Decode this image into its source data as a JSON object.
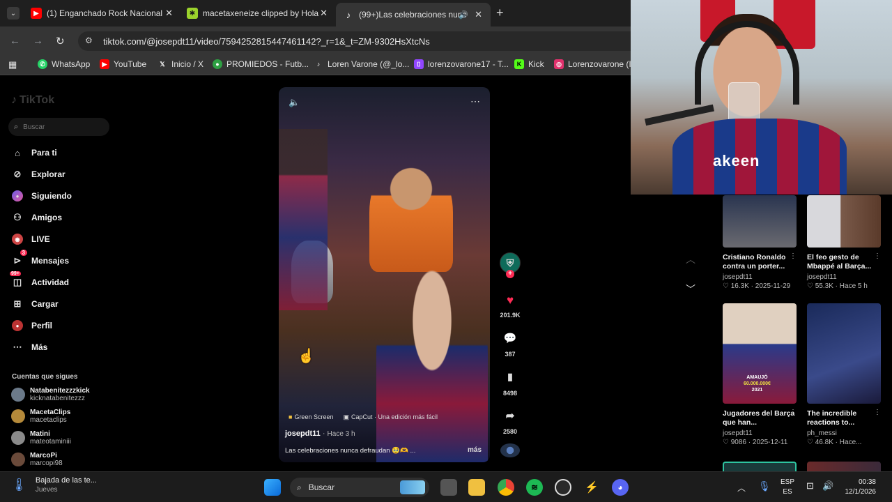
{
  "browser": {
    "tabs": [
      {
        "title": "(1) Enganchado Rock Nacional",
        "favicon": "youtube-icon",
        "color": "#ff0000"
      },
      {
        "title": "macetaxeneize clipped by Hola",
        "favicon": "clip-icon",
        "color": "#9bd32c"
      },
      {
        "title": "(99+)Las celebraciones nunc",
        "favicon": "tiktok-icon",
        "color": "#ffffff"
      }
    ],
    "new_tab": "+",
    "url": "tiktok.com/@josepdt11/video/7594252815447461142?_r=1&_t=ZM-9302HsXtcNs",
    "bookmarks": [
      {
        "label": "WhatsApp",
        "icon": "whatsapp-icon",
        "color": "#25d366"
      },
      {
        "label": "YouTube",
        "icon": "youtube-icon",
        "color": "#ff0000"
      },
      {
        "label": "Inicio / X",
        "icon": "x-icon",
        "color": "#ffffff"
      },
      {
        "label": "PROMIEDOS - Futb...",
        "icon": "promiedos-icon",
        "color": "#2ea043"
      },
      {
        "label": "Loren Varone (@_lo...",
        "icon": "tiktok-icon",
        "color": "#ffffff"
      },
      {
        "label": "lorenzovarone17 - T...",
        "icon": "twitch-icon",
        "color": "#9146ff"
      },
      {
        "label": "Kick",
        "icon": "kick-icon",
        "color": "#53fc18"
      },
      {
        "label": "Lorenzovarone (In",
        "icon": "instagram-icon",
        "color": "#e1306c"
      }
    ]
  },
  "tiktok": {
    "logo": "TikTok",
    "search_placeholder": "Buscar",
    "nav": [
      {
        "label": "Para ti",
        "icon": "home-icon"
      },
      {
        "label": "Explorar",
        "icon": "compass-icon"
      },
      {
        "label": "Siguiendo",
        "icon": "following-icon"
      },
      {
        "label": "Amigos",
        "icon": "friends-icon"
      },
      {
        "label": "LIVE",
        "icon": "live-icon"
      },
      {
        "label": "Mensajes",
        "icon": "messages-icon",
        "badge": "3"
      },
      {
        "label": "Actividad",
        "icon": "activity-icon",
        "badge": "99+"
      },
      {
        "label": "Cargar",
        "icon": "upload-icon"
      },
      {
        "label": "Perfil",
        "icon": "profile-icon"
      },
      {
        "label": "Más",
        "icon": "more-icon"
      }
    ],
    "following_title": "Cuentas que sigues",
    "following": [
      {
        "name": "Natabenitezzzkick",
        "handle": "kicknatabenitezzz",
        "color": "#6b7a8a"
      },
      {
        "name": "MacetaClips",
        "handle": "macetaclips",
        "color": "#b58a3a"
      },
      {
        "name": "Matini",
        "handle": "mateotaminiii",
        "color": "#8a8a8a"
      },
      {
        "name": "MarcoPi",
        "handle": "marcopi98",
        "color": "#6a4a3a"
      }
    ],
    "video": {
      "tags": [
        "Green Screen",
        "CapCut · Una edición más fácil"
      ],
      "author": "josepdt11",
      "time": "Hace 3 h",
      "caption": "Las celebraciones nunca defraudan 🥹🫶 ...",
      "more": "más",
      "likes": "201.9K",
      "comments": "387",
      "saves": "8498",
      "shares": "2580"
    },
    "related": [
      {
        "title": "Cristiano Ronaldo contra un porter...",
        "author": "josepdt11",
        "views": "16.3K",
        "date": "2025-11-29",
        "color1": "#2a3550",
        "color2": "#6a6a70"
      },
      {
        "title": "El feo gesto de Mbappé al Barça...",
        "author": "josepdt11",
        "views": "55.3K",
        "date": "Hace 5 h",
        "color1": "#d8d8dc",
        "color2": "#7a5a4a"
      },
      {
        "title": "Jugadores del Barça que han...",
        "author": "josepdt11",
        "views": "9086",
        "date": "2025-12-11",
        "color1": "#e0d0c0",
        "color2": "#2a3a8a"
      },
      {
        "title": "The incredible reactions to...",
        "author": "ph_messi",
        "views": "46.8K",
        "date": "Hace...",
        "color1": "#1a2a5a",
        "color2": "#3a4a8a"
      }
    ],
    "thumb_overlay_1": "AMAUJÓ",
    "thumb_overlay_2": "60.000.000€",
    "thumb_overlay_3": "2021"
  },
  "webcam": {
    "shirt_text": "akeen"
  },
  "taskbar": {
    "weather_title": "Bajada de las te...",
    "weather_sub": "Jueves",
    "search": "Buscar",
    "lang1": "ESP",
    "lang2": "ES",
    "time": "00:38",
    "date": "12/1/2026"
  }
}
